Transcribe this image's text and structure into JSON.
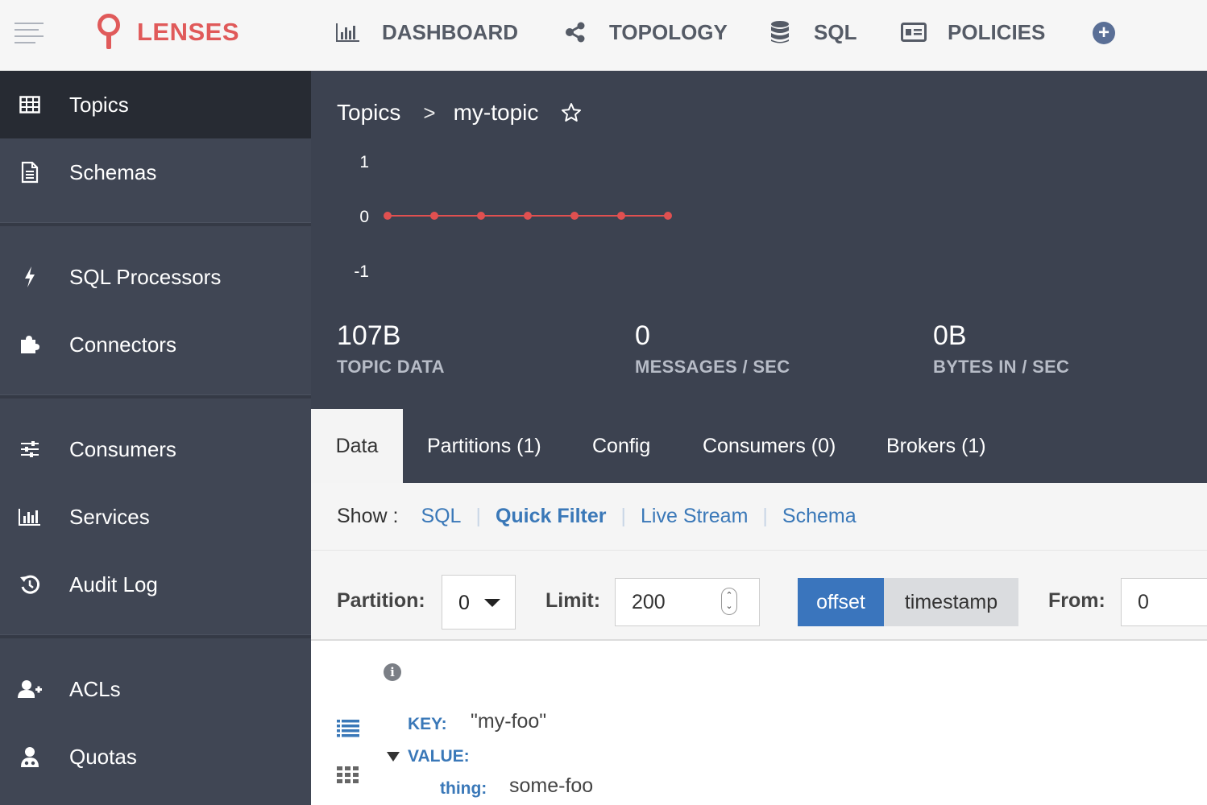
{
  "app": {
    "logo_text": "LENSES",
    "brand_color": "#e05a5a"
  },
  "topnav": [
    {
      "label": "DASHBOARD",
      "icon": "bar-chart-icon"
    },
    {
      "label": "TOPOLOGY",
      "icon": "share-nodes-icon"
    },
    {
      "label": "SQL",
      "icon": "database-icon"
    },
    {
      "label": "POLICIES",
      "icon": "id-card-icon"
    }
  ],
  "sidebar": {
    "items": [
      {
        "label": "Topics",
        "icon": "table-icon",
        "active": true
      },
      {
        "label": "Schemas",
        "icon": "document-icon"
      },
      {
        "label": "SQL Processors",
        "icon": "bolt-icon"
      },
      {
        "label": "Connectors",
        "icon": "puzzle-icon"
      },
      {
        "label": "Consumers",
        "icon": "sliders-icon"
      },
      {
        "label": "Services",
        "icon": "bar-chart-icon"
      },
      {
        "label": "Audit Log",
        "icon": "history-icon"
      },
      {
        "label": "ACLs",
        "icon": "user-plus-icon"
      },
      {
        "label": "Quotas",
        "icon": "user-doctor-icon"
      }
    ]
  },
  "breadcrumb": {
    "root": "Topics",
    "separator": ">",
    "current": "my-topic"
  },
  "chart_data": {
    "type": "line",
    "x": [
      1,
      2,
      3,
      4,
      5,
      6,
      7
    ],
    "values": [
      0,
      0,
      0,
      0,
      0,
      0,
      0
    ],
    "ylim": [
      -1,
      1
    ],
    "yticks": [
      "1",
      "0",
      "-1"
    ],
    "color": "#e05050"
  },
  "stats": [
    {
      "value": "107B",
      "label": "TOPIC DATA"
    },
    {
      "value": "0",
      "label": "MESSAGES / SEC"
    },
    {
      "value": "0B",
      "label": "BYTES IN / SEC"
    }
  ],
  "tabs": [
    "Data",
    "Partitions (1)",
    "Config",
    "Consumers (0)",
    "Brokers (1)"
  ],
  "show": {
    "label": "Show :",
    "links": [
      "SQL",
      "Quick Filter",
      "Live Stream",
      "Schema"
    ],
    "selected": "Quick Filter"
  },
  "filters": {
    "partition_label": "Partition:",
    "partition_value": "0",
    "limit_label": "Limit:",
    "limit_value": "200",
    "mode_options": [
      "offset",
      "timestamp"
    ],
    "mode_selected": "offset",
    "from_label": "From:",
    "from_value": "0"
  },
  "record": {
    "key_label": "KEY:",
    "key_value": "\"my-foo\"",
    "value_label": "VALUE:",
    "field_label": "thing:",
    "field_value": "some-foo"
  }
}
